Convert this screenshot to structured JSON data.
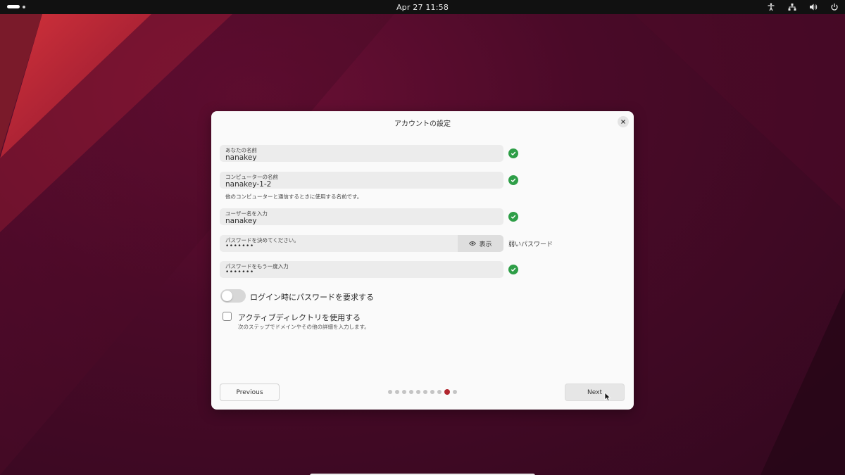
{
  "topbar": {
    "clock": "Apr 27  11:58",
    "icons": [
      "accessibility-icon",
      "network-icon",
      "volume-icon",
      "power-icon"
    ]
  },
  "dialog": {
    "title": "アカウントの設定",
    "fields": {
      "name": {
        "label": "あなたの名前",
        "value": "nanakey"
      },
      "computer": {
        "label": "コンピューターの名前",
        "value": "nanakey-1-2",
        "hint": "他のコンピューターと通信するときに使用する名前です。"
      },
      "username": {
        "label": "ユーザー名を入力",
        "value": "nanakey"
      },
      "password": {
        "label": "パスワードを決めてください。",
        "value": "•••••••",
        "show_label": "表示",
        "strength": "弱いパスワード"
      },
      "confirm": {
        "label": "パスワードをもう一度入力",
        "value": "•••••••"
      }
    },
    "require_password": {
      "label": "ログイン時にパスワードを要求する",
      "enabled": false
    },
    "active_directory": {
      "label": "アクティブディレクトリを使用する",
      "sub": "次のステップでドメインやその他の詳細を入力します。",
      "checked": false
    },
    "previous_label": "Previous",
    "next_label": "Next",
    "progress": {
      "total": 10,
      "current": 9
    }
  },
  "colors": {
    "accent": "#b1262e",
    "success": "#2e9e47",
    "topbar": "#111111"
  }
}
